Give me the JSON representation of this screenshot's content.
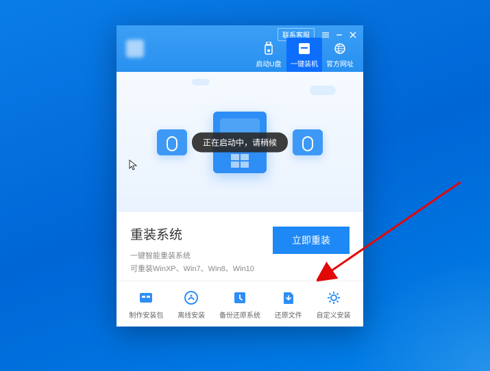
{
  "titlebar": {
    "contact_label": "联系客服"
  },
  "nav": {
    "tab1": "启动U盘",
    "tab2": "一键装机",
    "tab3": "官方网址"
  },
  "toast": "正在启动中，请稍候",
  "content": {
    "heading": "重装系统",
    "sub1": "一键智能重装系统",
    "sub2": "可重装WinXP、Win7、Win8、Win10",
    "primary_btn": "立即重装"
  },
  "bottom": {
    "item1": "制作安装包",
    "item2": "离线安装",
    "item3": "备份还原系统",
    "item4": "还原文件",
    "item5": "自定义安装"
  }
}
